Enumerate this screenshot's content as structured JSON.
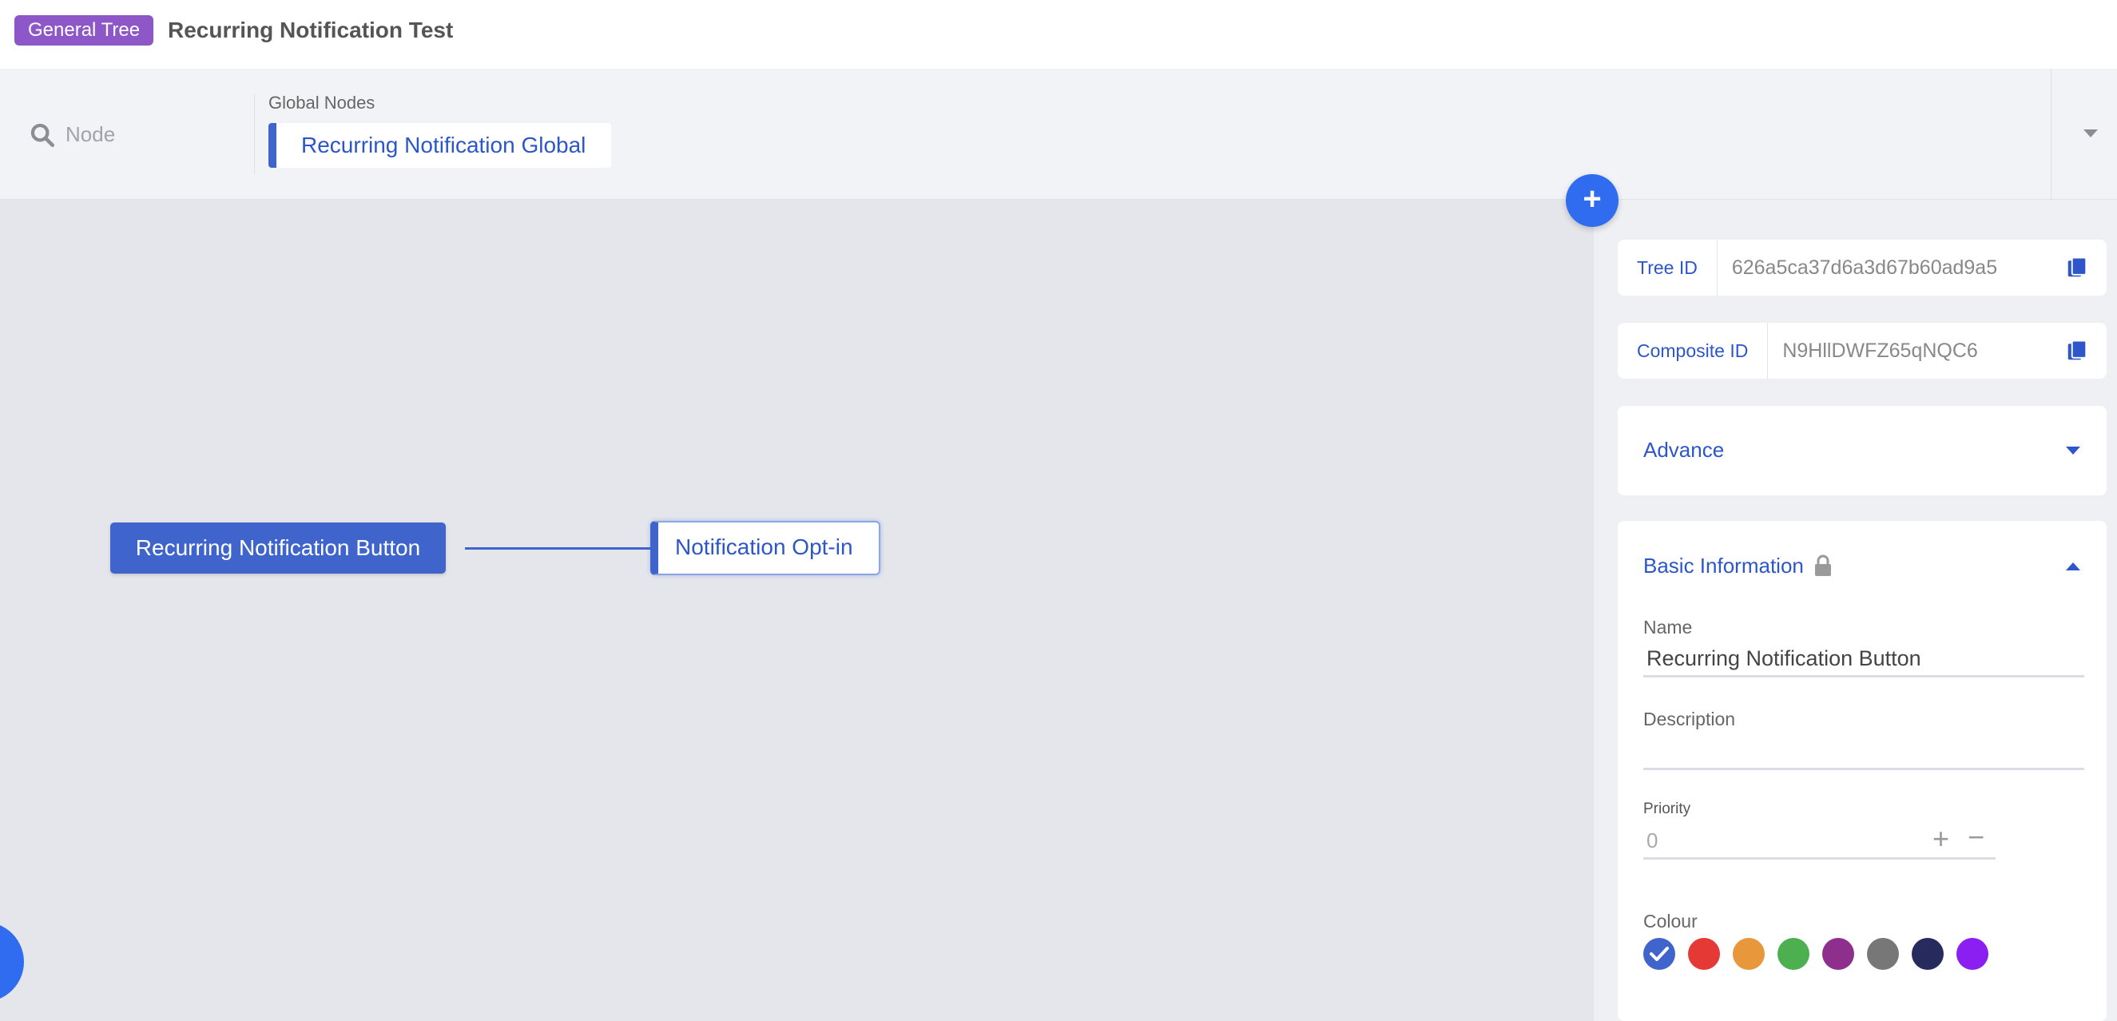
{
  "header": {
    "badge": "General Tree",
    "title": "Recurring Notification Test"
  },
  "nodebar": {
    "search_placeholder": "Node",
    "global_label": "Global Nodes",
    "global_nodes": [
      "Recurring Notification Global"
    ]
  },
  "canvas": {
    "root_node": "Recurring Notification Button",
    "child_node": "Notification Opt-in"
  },
  "add_button": "+",
  "panel": {
    "tree_id_label": "Tree ID",
    "tree_id_value": "626a5ca37d6a3d67b60ad9a5",
    "composite_id_label": "Composite ID",
    "composite_id_value": "N9HllDWFZ65qNQC6",
    "advance_label": "Advance",
    "basic_info": {
      "title": "Basic Information",
      "name_label": "Name",
      "name_value": "Recurring Notification Button",
      "description_label": "Description",
      "description_value": "",
      "priority_label": "Priority",
      "priority_value": "0",
      "priority_plus": "+",
      "priority_minus": "−",
      "colour_label": "Colour",
      "colours": [
        "#3f64cc",
        "#e53935",
        "#e8973a",
        "#4caf50",
        "#8e2f8e",
        "#777777",
        "#272a5c",
        "#8b1ef0"
      ],
      "selected_colour": "#3f64cc"
    }
  },
  "colors": {
    "accent": "#2c56c9",
    "node_fill": "#3f64cc",
    "badge": "#8e57c8",
    "fab": "#2f6cf0"
  }
}
